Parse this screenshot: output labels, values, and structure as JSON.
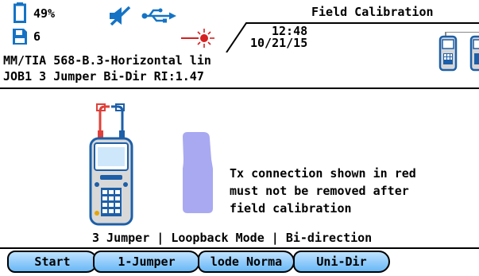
{
  "status": {
    "battery_percent": "49%",
    "storage_count": "6",
    "screen_title": "Field Calibration",
    "time": "12:48",
    "date": "10/21/15",
    "standard": "MM/TIA 568-B.3-Horizontal lin",
    "job_info": "JOB1 3 Jumper Bi-Dir RI:1.47"
  },
  "icons": {
    "battery": "battery-icon",
    "storage": "floppy-disk-icon",
    "mute": "speaker-muted-icon",
    "usb": "usb-icon",
    "laser": "laser-icon",
    "device_pair": "device-pair-icon"
  },
  "main": {
    "instruction_lines": [
      "Tx connection shown in red",
      "must not be removed after",
      "field calibration"
    ],
    "mode_summary": "3 Jumper | Loopback Mode | Bi-direction"
  },
  "softkeys": [
    {
      "label": "Start"
    },
    {
      "label": "1-Jumper"
    },
    {
      "label": "lode Norma"
    },
    {
      "label": "Uni-Dir"
    }
  ],
  "colors": {
    "accent_blue": "#69b8f6",
    "tx_red": "#e0403a",
    "remote_unit_purple": "#a9a9f2"
  }
}
